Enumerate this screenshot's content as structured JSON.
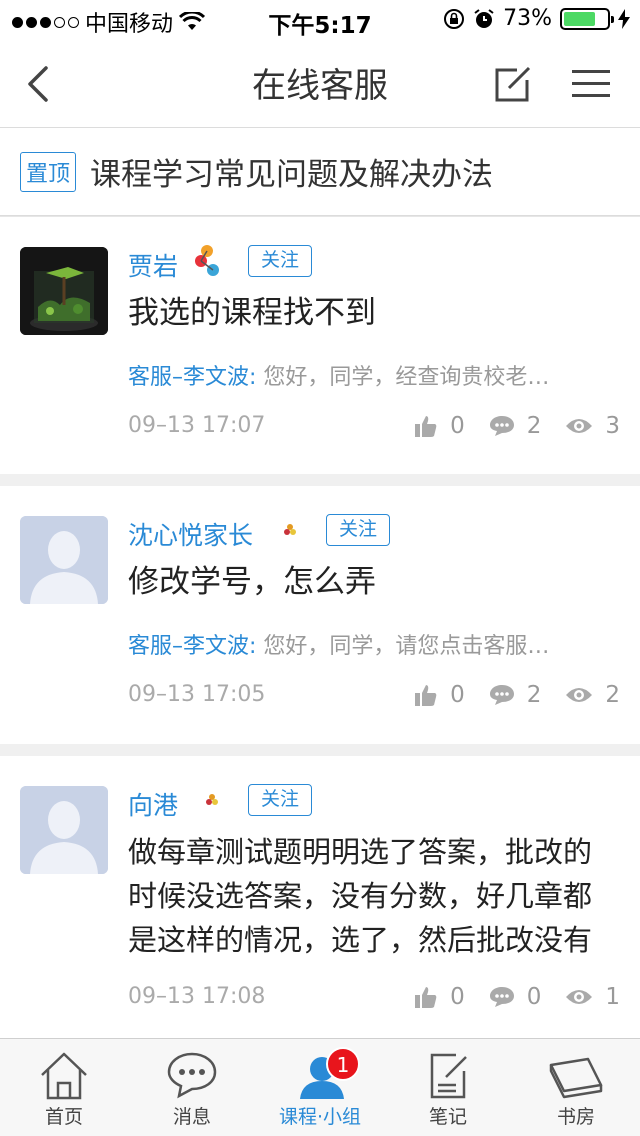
{
  "status_bar": {
    "carrier": "中国移动",
    "time": "下午5:17",
    "battery": "73%",
    "battery_level": 0.73
  },
  "nav": {
    "title": "在线客服",
    "back_icon": "chevron-left-icon",
    "edit_icon": "compose-icon",
    "menu_icon": "hamburger-icon"
  },
  "pinned": {
    "tag": "置顶",
    "text": "课程学习常见问题及解决办法"
  },
  "posts": [
    {
      "username": "贾岩",
      "follow_label": "关注",
      "title": "我选的课程找不到",
      "reply_author": "客服–李文波:",
      "reply_text": "您好，同学，经查询贵校老…",
      "time": "09–13 17:07",
      "likes": "0",
      "comments": "2",
      "views": "3"
    },
    {
      "username": "沈心悦家长",
      "follow_label": "关注",
      "title": "修改学号，怎么弄",
      "reply_author": "客服–李文波:",
      "reply_text": "您好，同学，请您点击客服…",
      "time": "09–13 17:05",
      "likes": "0",
      "comments": "2",
      "views": "2"
    },
    {
      "username": "向港",
      "follow_label": "关注",
      "title": "做每章测试题明明选了答案，批改的时候没选答案，没有分数，好几章都是这样的情况，选了，然后批改没有",
      "time": "09–13 17:08",
      "likes": "0",
      "comments": "0",
      "views": "1"
    }
  ],
  "tabs": [
    {
      "label": "首页",
      "icon": "home-icon"
    },
    {
      "label": "消息",
      "icon": "chat-bubble-icon"
    },
    {
      "label": "课程·小组",
      "icon": "group-icon",
      "badge": "1"
    },
    {
      "label": "笔记",
      "icon": "note-icon"
    },
    {
      "label": "书房",
      "icon": "book-icon"
    }
  ],
  "colors": {
    "accent": "#2a8ad6",
    "badge": "#e8151c",
    "battery": "#4cd964"
  }
}
